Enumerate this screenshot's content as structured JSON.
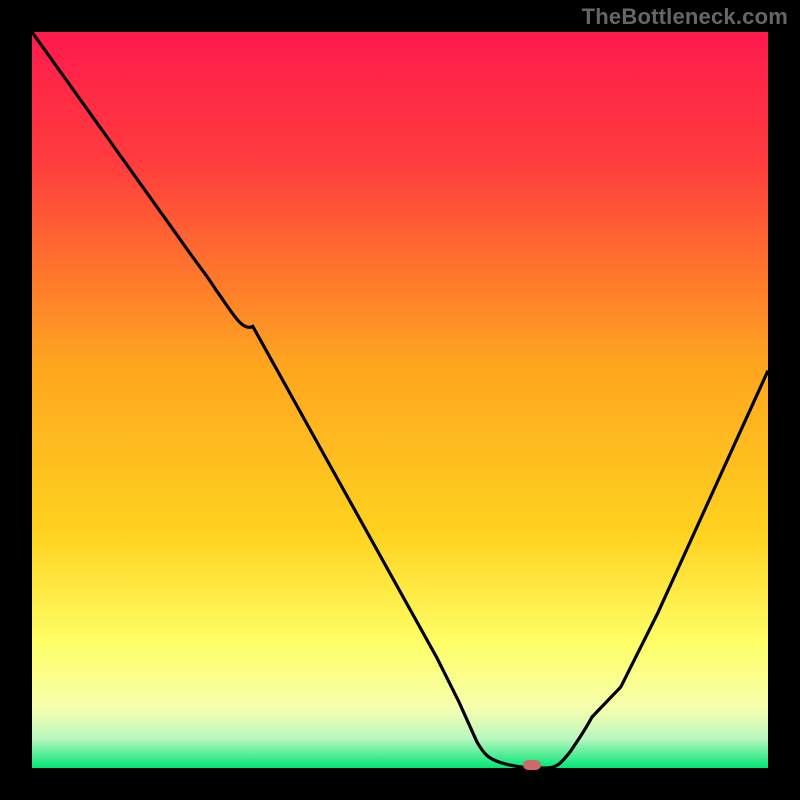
{
  "watermark": "TheBottleneck.com",
  "colors": {
    "bg": "#000000",
    "gradient_top": "#ff1a4d",
    "gradient_mid": "#ffc400",
    "gradient_low": "#ffff66",
    "gradient_bottom": "#00e673",
    "curve": "#000000",
    "marker": "#cc6a6a"
  },
  "chart_data": {
    "type": "line",
    "title": "",
    "xlabel": "",
    "ylabel": "",
    "xlim": [
      0,
      100
    ],
    "ylim": [
      0,
      100
    ],
    "x": [
      0,
      5,
      10,
      15,
      20,
      25,
      30,
      35,
      40,
      45,
      50,
      55,
      58,
      62,
      65,
      68,
      70,
      75,
      80,
      85,
      90,
      95,
      100
    ],
    "values": [
      100,
      93,
      86,
      79,
      72,
      67,
      60,
      51,
      42,
      33,
      24,
      15,
      9,
      3,
      1,
      0,
      0,
      3,
      11,
      21,
      32,
      43,
      54
    ],
    "marker": {
      "x": 68,
      "y": 0
    },
    "legend": []
  }
}
